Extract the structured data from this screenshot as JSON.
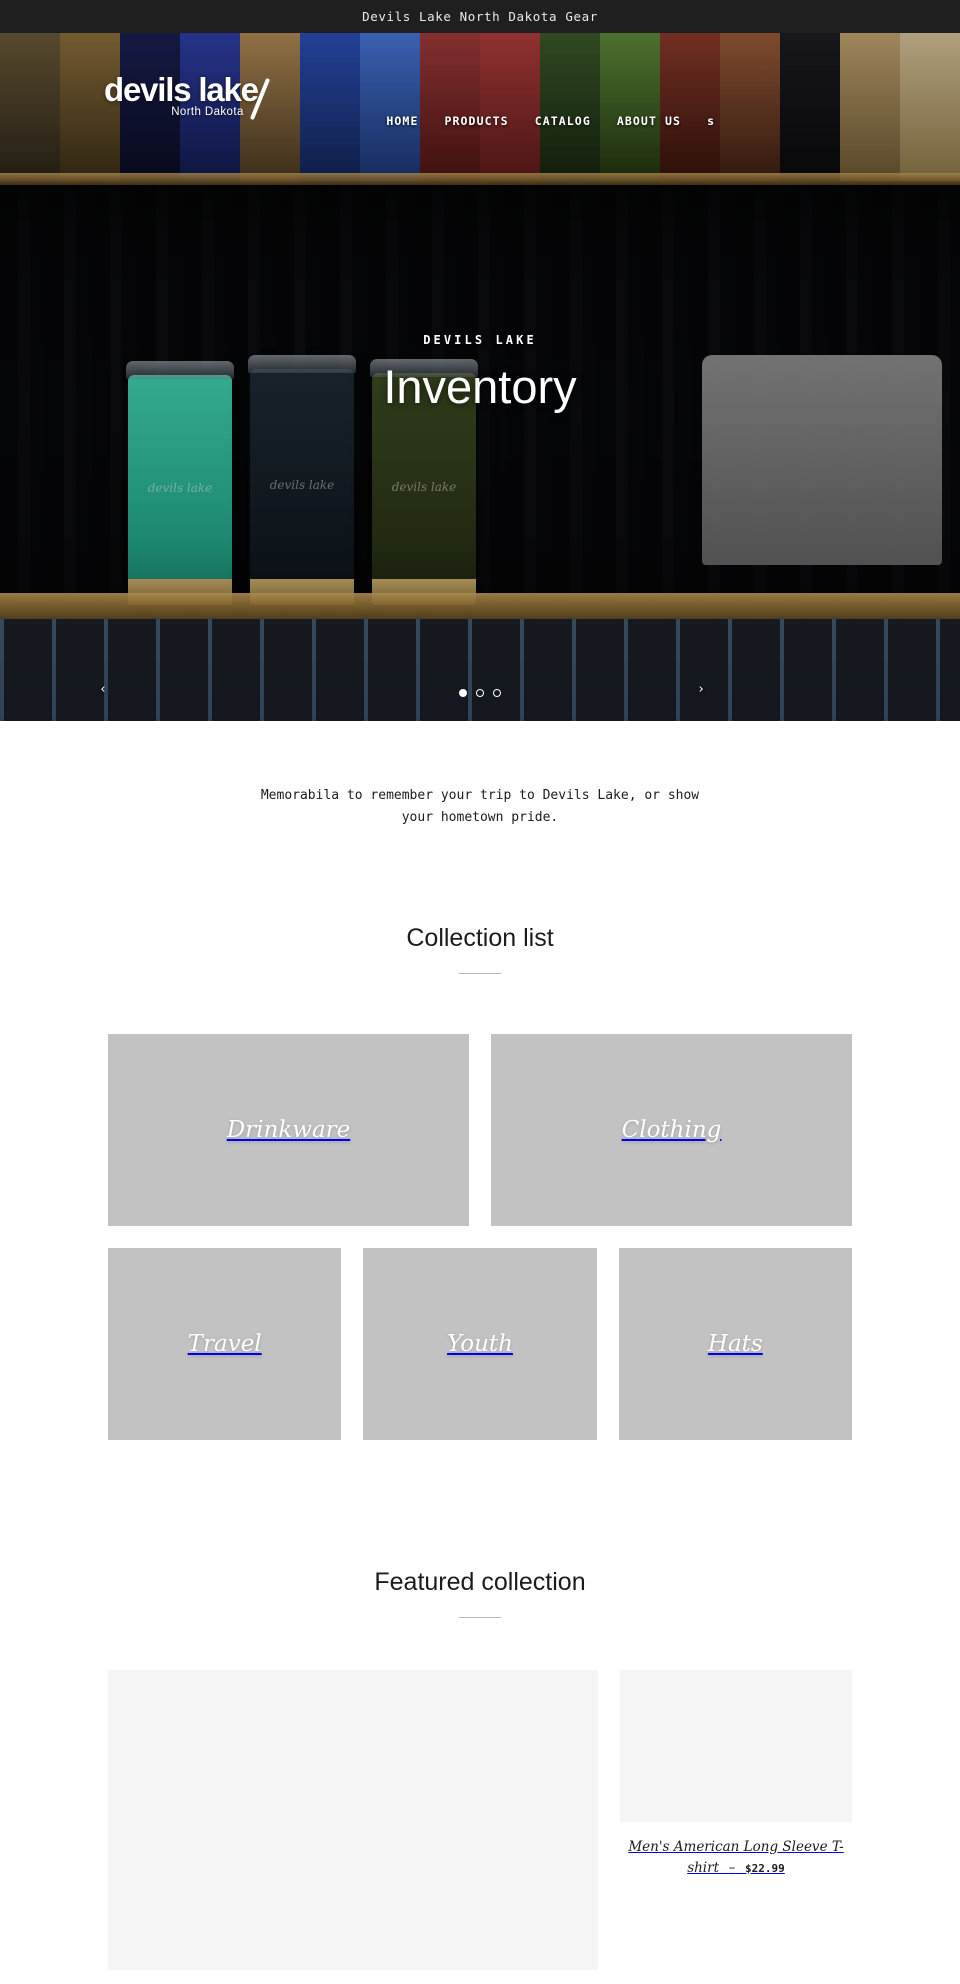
{
  "announcement": {
    "text": "Devils Lake North Dakota Gear"
  },
  "header": {
    "logo": {
      "main": "devils lake",
      "sub": "North Dakota"
    },
    "nav": [
      {
        "label": "HOME"
      },
      {
        "label": "PRODUCTS"
      },
      {
        "label": "CATALOG"
      },
      {
        "label": "ABOUT US"
      }
    ],
    "search_icon": "s",
    "search_icon_name": "search-icon"
  },
  "hero": {
    "kicker": "DEVILS LAKE",
    "title": "Inventory",
    "prev_arrow": "‹",
    "next_arrow": "›",
    "slides": 3,
    "active_slide": 1,
    "tumbler_brand": "devils lake"
  },
  "intro": {
    "text": "Memorabila to remember your trip to Devils Lake, or show your hometown pride."
  },
  "collection_list": {
    "title": "Collection list",
    "row1": [
      {
        "label": "Drinkware"
      },
      {
        "label": "Clothing"
      }
    ],
    "row2": [
      {
        "label": "Travel"
      },
      {
        "label": "Youth"
      },
      {
        "label": "Hats"
      }
    ]
  },
  "featured": {
    "title": "Featured collection",
    "products": [
      {
        "title": "",
        "dash": "",
        "price": ""
      },
      {
        "title": "Men's American Long Sleeve T-shirt",
        "dash": "–",
        "price": "$22.99"
      }
    ]
  },
  "colors": {
    "announcement_bg": "#1f1f1f",
    "tile_bg": "#c2c2c2",
    "product_media_bg": "#f5f5f5",
    "text": "#1c1c1c",
    "rule": "#b9b9b9"
  }
}
